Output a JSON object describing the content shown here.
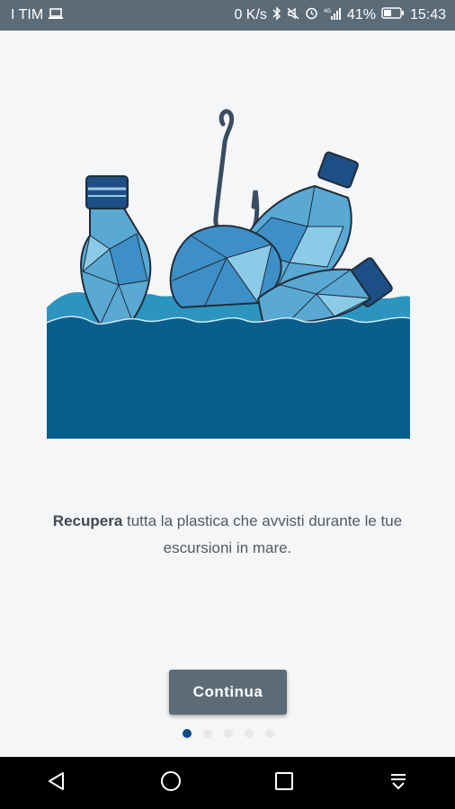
{
  "status_bar": {
    "carrier": "I TIM",
    "net_speed": "0 K/s",
    "battery": "41%",
    "time": "15:43",
    "network_type": "4G"
  },
  "colors": {
    "status_bar": "#5c6b78",
    "sea_dark": "#0a5e8c",
    "sea_light": "#2b95bf",
    "dot_active": "#0f4c85",
    "button": "#5c6b78"
  },
  "onboarding": {
    "caption_bold": "Recupera",
    "caption_rest": " tutta la plastica che avvisti durante le tue escursioni in mare.",
    "continue_label": "Continua",
    "page_count": 5,
    "current_page": 1
  },
  "icons": {
    "status_bar": [
      "laptop-icon",
      "bluetooth-icon",
      "mute-icon",
      "alarm-icon",
      "signal-icon",
      "battery-icon"
    ],
    "nav_bar": [
      "back-icon",
      "home-icon",
      "recents-icon",
      "notification-pull-icon"
    ]
  }
}
